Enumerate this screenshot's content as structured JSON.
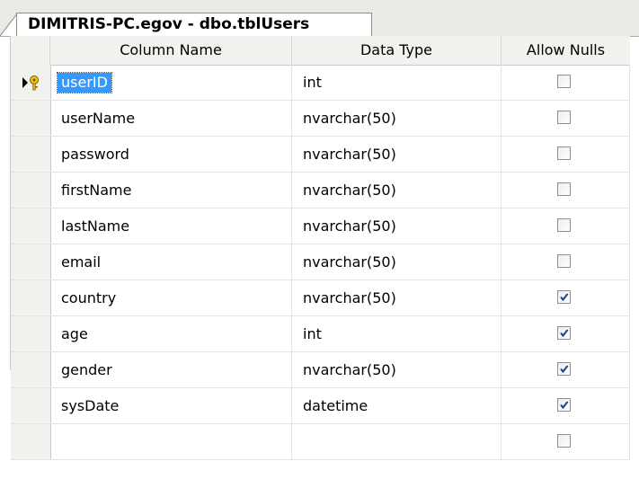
{
  "tab": {
    "title": "DIMITRIS-PC.egov - dbo.tblUsers"
  },
  "headers": {
    "column_name": "Column Name",
    "data_type": "Data Type",
    "allow_nulls": "Allow Nulls"
  },
  "rows": [
    {
      "name": "userID",
      "type": "int",
      "allow_nulls": false
    },
    {
      "name": "userName",
      "type": "nvarchar(50)",
      "allow_nulls": false
    },
    {
      "name": "password",
      "type": "nvarchar(50)",
      "allow_nulls": false
    },
    {
      "name": "firstName",
      "type": "nvarchar(50)",
      "allow_nulls": false
    },
    {
      "name": "lastName",
      "type": "nvarchar(50)",
      "allow_nulls": false
    },
    {
      "name": "email",
      "type": "nvarchar(50)",
      "allow_nulls": false
    },
    {
      "name": "country",
      "type": "nvarchar(50)",
      "allow_nulls": true
    },
    {
      "name": "age",
      "type": "int",
      "allow_nulls": true
    },
    {
      "name": "gender",
      "type": "nvarchar(50)",
      "allow_nulls": true
    },
    {
      "name": "sysDate",
      "type": "datetime",
      "allow_nulls": true
    },
    {
      "name": "",
      "type": "",
      "allow_nulls": false
    }
  ],
  "selected_row": 0,
  "icons": {
    "current_row": "current-row-arrow-icon",
    "primary_key": "primary-key-icon"
  },
  "colors": {
    "selection": "#3399ff",
    "check": "#1c3d8f"
  }
}
